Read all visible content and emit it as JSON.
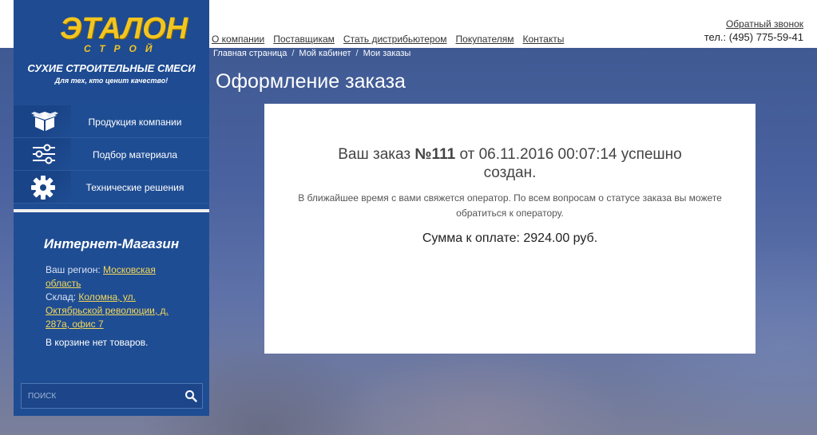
{
  "header": {
    "nav": [
      {
        "label": "О компании"
      },
      {
        "label": "Поставщикам"
      },
      {
        "label": "Стать дистрибьютером"
      },
      {
        "label": "Покупателям"
      },
      {
        "label": "Контакты"
      }
    ],
    "callback_label": "Обратный звонок",
    "phone": "тел.: (495) 775-59-41"
  },
  "logo": {
    "main": "ЭТАЛОН",
    "sub": "СТРОЙ",
    "tagline": "СУХИЕ СТРОИТЕЛЬНЫЕ СМЕСИ",
    "slogan": "Для тех, кто ценит качество!",
    "color": "#f3c520"
  },
  "sidebar": {
    "menu": [
      {
        "label": "Продукция компании",
        "icon": "box-icon"
      },
      {
        "label": "Подбор материала",
        "icon": "sliders-icon"
      },
      {
        "label": "Технические решения",
        "icon": "gear-icon"
      }
    ],
    "shop": {
      "title": "Интернет-Магазин",
      "region_label": "Ваш регион:",
      "region_value": "Московская область",
      "warehouse_label": "Склад:",
      "warehouse_value": "Коломна, ул. Октябрьской революции, д. 287а, офис 7",
      "cart_status": "В корзине нет товаров."
    },
    "search": {
      "placeholder": "поиск",
      "icon": "search-icon"
    },
    "color": "#1f4d93"
  },
  "breadcrumb": {
    "items": [
      "Главная страница",
      "Мой кабинет",
      "Мои заказы"
    ],
    "separator": "/"
  },
  "page": {
    "title": "Оформление заказа"
  },
  "order": {
    "prefix": "Ваш заказ",
    "number": "№111",
    "date_text": "от 06.11.2016 00:07:14 успешно создан.",
    "note": "В ближайшее время с вами свяжется оператор. По всем вопросам о статусе заказа вы можете обратиться к оператору.",
    "sum_text": "Сумма к оплате: 2924.00 руб."
  }
}
